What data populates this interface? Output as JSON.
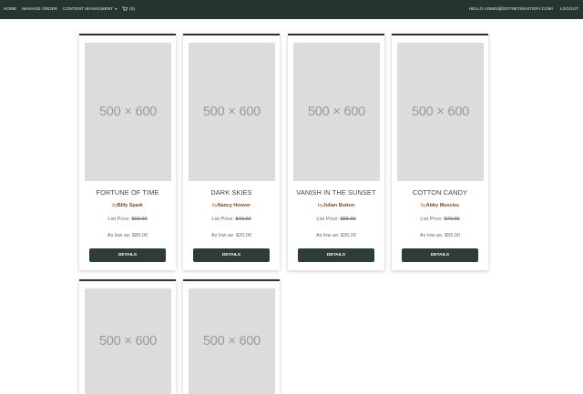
{
  "nav": {
    "home": "HOME",
    "manage_order": "MANAGE ORDER",
    "content_management": "CONTENT MANAGMENT",
    "cart_count": "(0)",
    "greeting": "HELLO ADMIN@DOTNETMASTERY.COM!",
    "logout": "LOGOUT"
  },
  "products": [
    {
      "placeholder": "500 × 600",
      "title": "FORTUNE OF TIME",
      "by": "by",
      "author": "Billy Spark",
      "list_label": "List Price: ",
      "list_price": "$99.00",
      "as_low": "As low as: $80.00",
      "button": "DETAILS"
    },
    {
      "placeholder": "500 × 600",
      "title": "DARK SKIES",
      "by": "by",
      "author": "Nancy Hoover",
      "list_label": "List Price: ",
      "list_price": "$40.00",
      "as_low": "As low as: $20.00",
      "button": "DETAILS"
    },
    {
      "placeholder": "500 × 600",
      "title": "VANISH IN THE SUNSET",
      "by": "by",
      "author": "Julian Button",
      "list_label": "List Price: ",
      "list_price": "$55.00",
      "as_low": "As low as: $35.00",
      "button": "DETAILS"
    },
    {
      "placeholder": "500 × 600",
      "title": "COTTON CANDY",
      "by": "by",
      "author": "Abby Muscles",
      "list_label": "List Price: ",
      "list_price": "$70.00",
      "as_low": "As low as: $55.00",
      "button": "DETAILS"
    },
    {
      "placeholder": "500 × 600"
    },
    {
      "placeholder": "500 × 600"
    }
  ]
}
